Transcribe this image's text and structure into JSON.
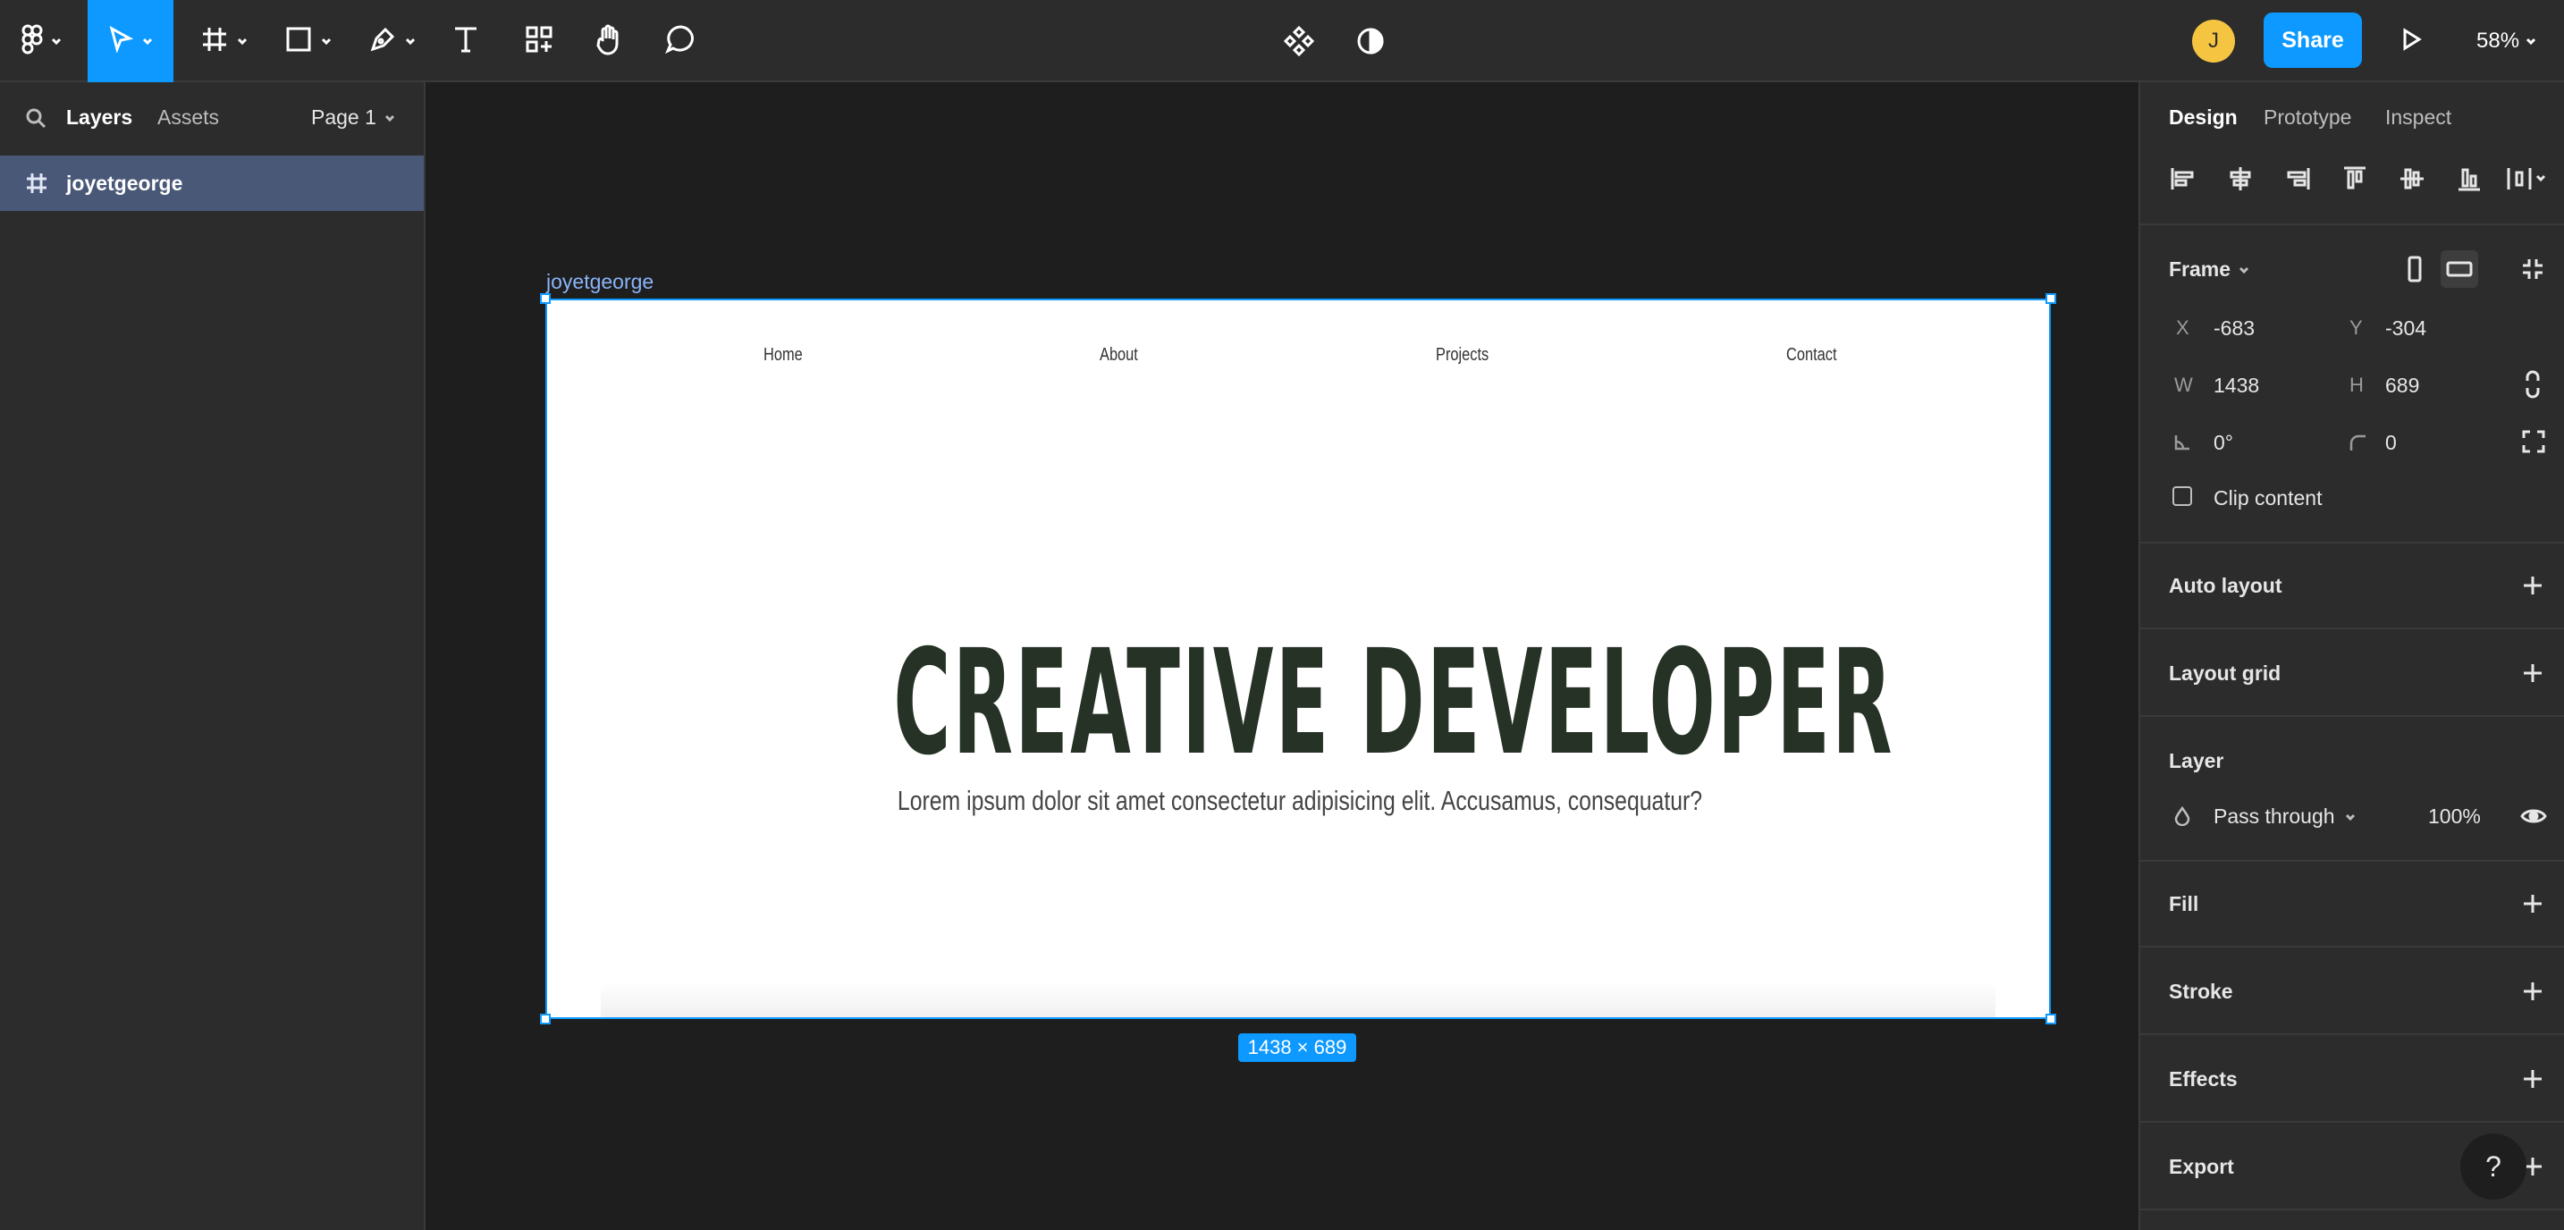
{
  "toolbar": {
    "tools": [
      {
        "name": "main-menu",
        "icon": "figma-logo-icon"
      },
      {
        "name": "move-tool",
        "icon": "cursor-icon",
        "active": true
      },
      {
        "name": "frame-tool",
        "icon": "frame-hash-icon"
      },
      {
        "name": "shape-tool",
        "icon": "rectangle-icon"
      },
      {
        "name": "pen-tool",
        "icon": "pen-icon"
      },
      {
        "name": "text-tool",
        "icon": "text-icon"
      },
      {
        "name": "resources-tool",
        "icon": "components-icon"
      },
      {
        "name": "hand-tool",
        "icon": "hand-icon"
      },
      {
        "name": "comment-tool",
        "icon": "comment-icon"
      }
    ],
    "center_icons": [
      "component-diamond-icon",
      "contrast-icon"
    ],
    "avatar_initial": "J",
    "share_label": "Share",
    "zoom": "58%",
    "accent_color": "#0d99ff"
  },
  "left_panel": {
    "tabs": [
      "Layers",
      "Assets"
    ],
    "active_tab": "Layers",
    "page": "Page 1",
    "layers": [
      {
        "name": "joyetgeorge",
        "type": "frame",
        "selected": true
      }
    ]
  },
  "canvas": {
    "frame_label": "joyetgeorge",
    "size_badge": "1438 × 689",
    "nav": [
      "Home",
      "About",
      "Projects",
      "Contact"
    ],
    "hero_title": "CREATIVE DEVELOPER",
    "hero_subtitle": "Lorem ipsum dolor sit amet consectetur adipisicing elit. Accusamus, consequatur?",
    "hero_color": "#263226"
  },
  "right_panel": {
    "tabs": [
      "Design",
      "Prototype",
      "Inspect"
    ],
    "active_tab": "Design",
    "frame": {
      "title": "Frame",
      "x_label": "X",
      "x": "-683",
      "y_label": "Y",
      "y": "-304",
      "w_label": "W",
      "w": "1438",
      "h_label": "H",
      "h": "689",
      "rotation": "0°",
      "radius": "0",
      "clip_content": "Clip content"
    },
    "sections": {
      "auto_layout": "Auto layout",
      "layout_grid": "Layout grid",
      "layer": "Layer",
      "fill": "Fill",
      "stroke": "Stroke",
      "effects": "Effects",
      "export": "Export"
    },
    "layer": {
      "blend_mode": "Pass through",
      "opacity": "100%"
    }
  },
  "help": "?"
}
